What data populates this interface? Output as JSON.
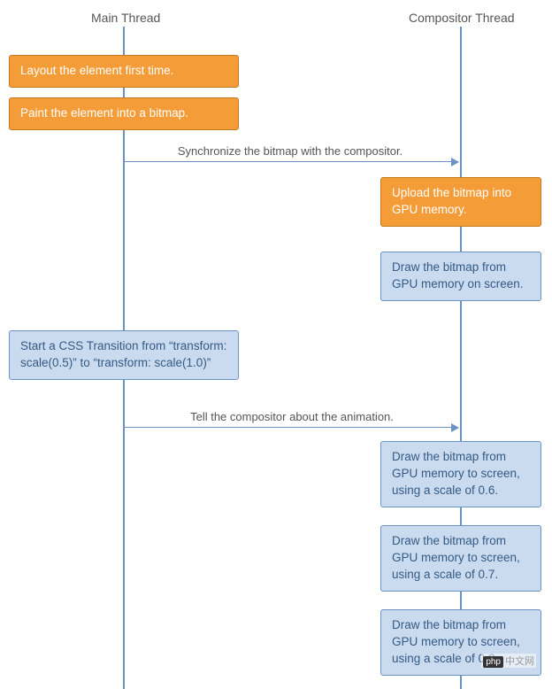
{
  "headers": {
    "main": "Main Thread",
    "compositor": "Compositor Thread"
  },
  "boxes": {
    "layout": "Layout the element first time.",
    "paint": "Paint the element into a bitmap.",
    "upload": "Upload the bitmap into GPU memory.",
    "draw1": "Draw the bitmap from GPU memory on screen.",
    "startTransition": "Start a CSS Transition from “transform: scale(0.5)” to “transform: scale(1.0)”",
    "draw06": "Draw the bitmap from GPU memory to screen, using a scale of 0.6.",
    "draw07": "Draw the bitmap from GPU memory to screen, using a scale of 0.7.",
    "draw08": "Draw the bitmap from GPU memory to screen, using a scale of 0.8."
  },
  "arrows": {
    "sync": "Synchronize the bitmap with the compositor.",
    "tell": "Tell the compositor about the animation."
  },
  "watermark": {
    "logo": "php",
    "text": "中文网"
  }
}
